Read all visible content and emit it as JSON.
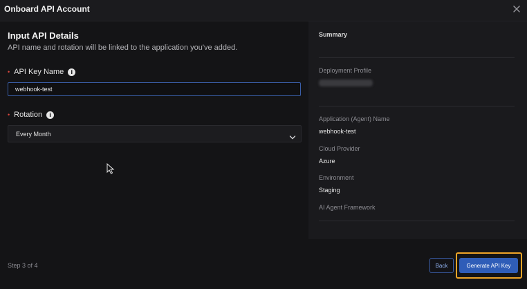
{
  "dialog": {
    "title": "Onboard API Account"
  },
  "form": {
    "heading": "Input API Details",
    "subheading": "API name and rotation will be linked to the application you've added.",
    "api_key_name": {
      "label": "API Key Name",
      "required_mark": "•",
      "value": "webhook-test"
    },
    "rotation": {
      "label": "Rotation",
      "required_mark": "•",
      "selected": "Every Month"
    }
  },
  "summary": {
    "title": "Summary",
    "deployment_profile_label": "Deployment Profile",
    "application_name_label": "Application (Agent) Name",
    "application_name_value": "webhook-test",
    "cloud_provider_label": "Cloud Provider",
    "cloud_provider_value": "Azure",
    "environment_label": "Environment",
    "environment_value": "Staging",
    "framework_label": "AI Agent Framework"
  },
  "footer": {
    "step": "Step 3 of 4",
    "back_label": "Back",
    "generate_label": "Generate API Key"
  },
  "colors": {
    "accent": "#2f5db8",
    "highlight": "#f0a528",
    "required": "#e0483f"
  },
  "icons": [
    "close-icon",
    "info-icon",
    "chevron-down-icon",
    "mouse-cursor-icon"
  ]
}
